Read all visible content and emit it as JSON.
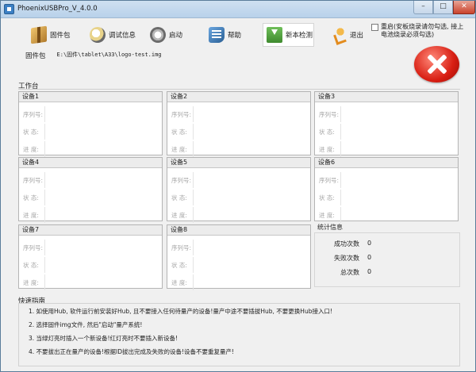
{
  "window": {
    "title": "PhoenixUSBPro_V_4.0.0"
  },
  "toolbar": {
    "firmware": "固件包",
    "debug": "调试信息",
    "start": "启动",
    "help": "帮助",
    "check_update": "新本检测",
    "exit": "退出"
  },
  "reboot": {
    "label": "重启(安板烧录请勿勾选, 接上电池烧录必须勾选)",
    "checked": false
  },
  "firmware_path": {
    "label": "固件包",
    "value": "E:\\固件\\tablet\\A33\\logo-test.img"
  },
  "workbench": {
    "label": "工作台"
  },
  "device_fields": {
    "serial": "序列号:",
    "status": "状  态:",
    "progress": "进  度:"
  },
  "devices": [
    {
      "name": "设备1"
    },
    {
      "name": "设备2"
    },
    {
      "name": "设备3"
    },
    {
      "name": "设备4"
    },
    {
      "name": "设备5"
    },
    {
      "name": "设备6"
    },
    {
      "name": "设备7"
    },
    {
      "name": "设备8"
    }
  ],
  "stats": {
    "title": "统计信息",
    "success_label": "成功次数",
    "success_value": "0",
    "fail_label": "失败次数",
    "fail_value": "0",
    "total_label": "总次数",
    "total_value": "0"
  },
  "guide": {
    "label": "快速指南",
    "tips": [
      "1. 如使用Hub, 软件运行前安装好Hub, 且不要接入任何待量产的设备!量产中途不要插拔Hub, 不要更换Hub接入口!",
      "2. 选择固件img文件, 然后\"启动\"量产系统!",
      "3. 当绿灯亮时插入一个新设备!红灯亮时不要插入新设备!",
      "4. 不要拔出正在量产的设备!根据ID拔出完成及失败的设备!设备不要重复量产!"
    ]
  },
  "colors": {
    "stop": "#d81e12",
    "titlebar": "#b8d1ea",
    "close": "#c9432c"
  }
}
